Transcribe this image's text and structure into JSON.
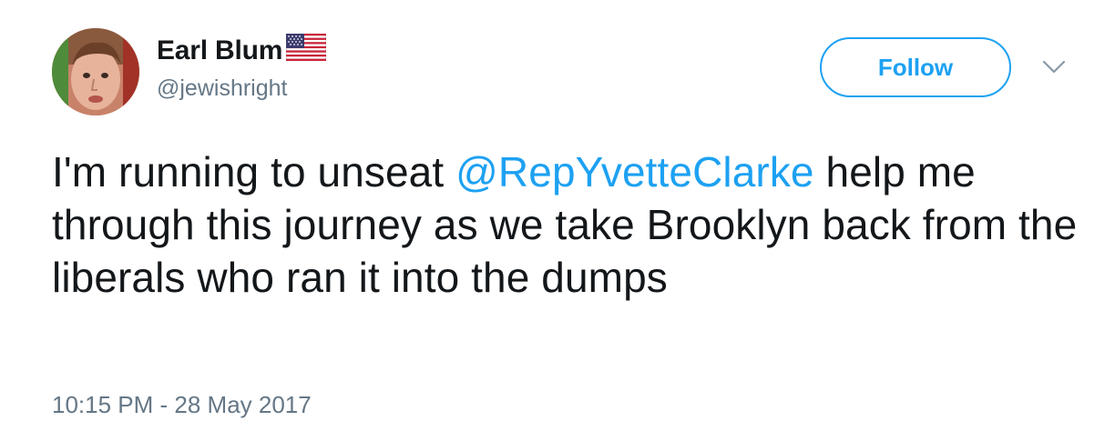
{
  "user": {
    "display_name": "Earl Blum",
    "flag_icon": "us-flag-icon",
    "handle": "@jewishright",
    "avatar_icon": "profile-photo"
  },
  "actions": {
    "follow_label": "Follow",
    "menu_icon": "chevron-down-icon"
  },
  "tweet": {
    "text_before": "I'm running to unseat ",
    "mention": "@RepYvetteClarke",
    "text_after": " help me through this journey as we take Brooklyn back from the liberals who ran it into the dumps",
    "timestamp": "10:15 PM - 28 May 2017"
  },
  "colors": {
    "link": "#1da1f2",
    "text": "#14171a",
    "muted": "#657786"
  }
}
